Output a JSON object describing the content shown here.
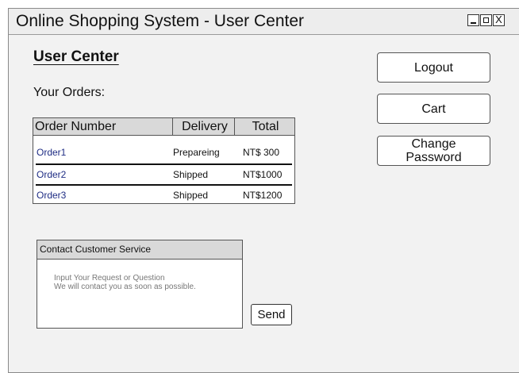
{
  "window": {
    "title": "Online Shopping System - User Center",
    "controls": {
      "close_glyph": "X"
    }
  },
  "user_center": {
    "heading": "User Center",
    "orders_label": "Your Orders:"
  },
  "orders_table": {
    "columns": [
      "Order Number",
      "Delivery",
      "Total"
    ],
    "rows": [
      {
        "order": "Order1",
        "delivery": "Prepareing",
        "total": "NT$ 300"
      },
      {
        "order": "Order2",
        "delivery": "Shipped",
        "total": "NT$1000"
      },
      {
        "order": "Order3",
        "delivery": "Shipped",
        "total": "NT$1200"
      }
    ]
  },
  "buttons": {
    "logout": "Logout",
    "cart": "Cart",
    "change_password_line1": "Change",
    "change_password_line2": "Password",
    "send": "Send"
  },
  "contact": {
    "header": "Contact Customer Service",
    "placeholder": "Input Your Request or Question\nWe will contact you as soon as possible."
  }
}
